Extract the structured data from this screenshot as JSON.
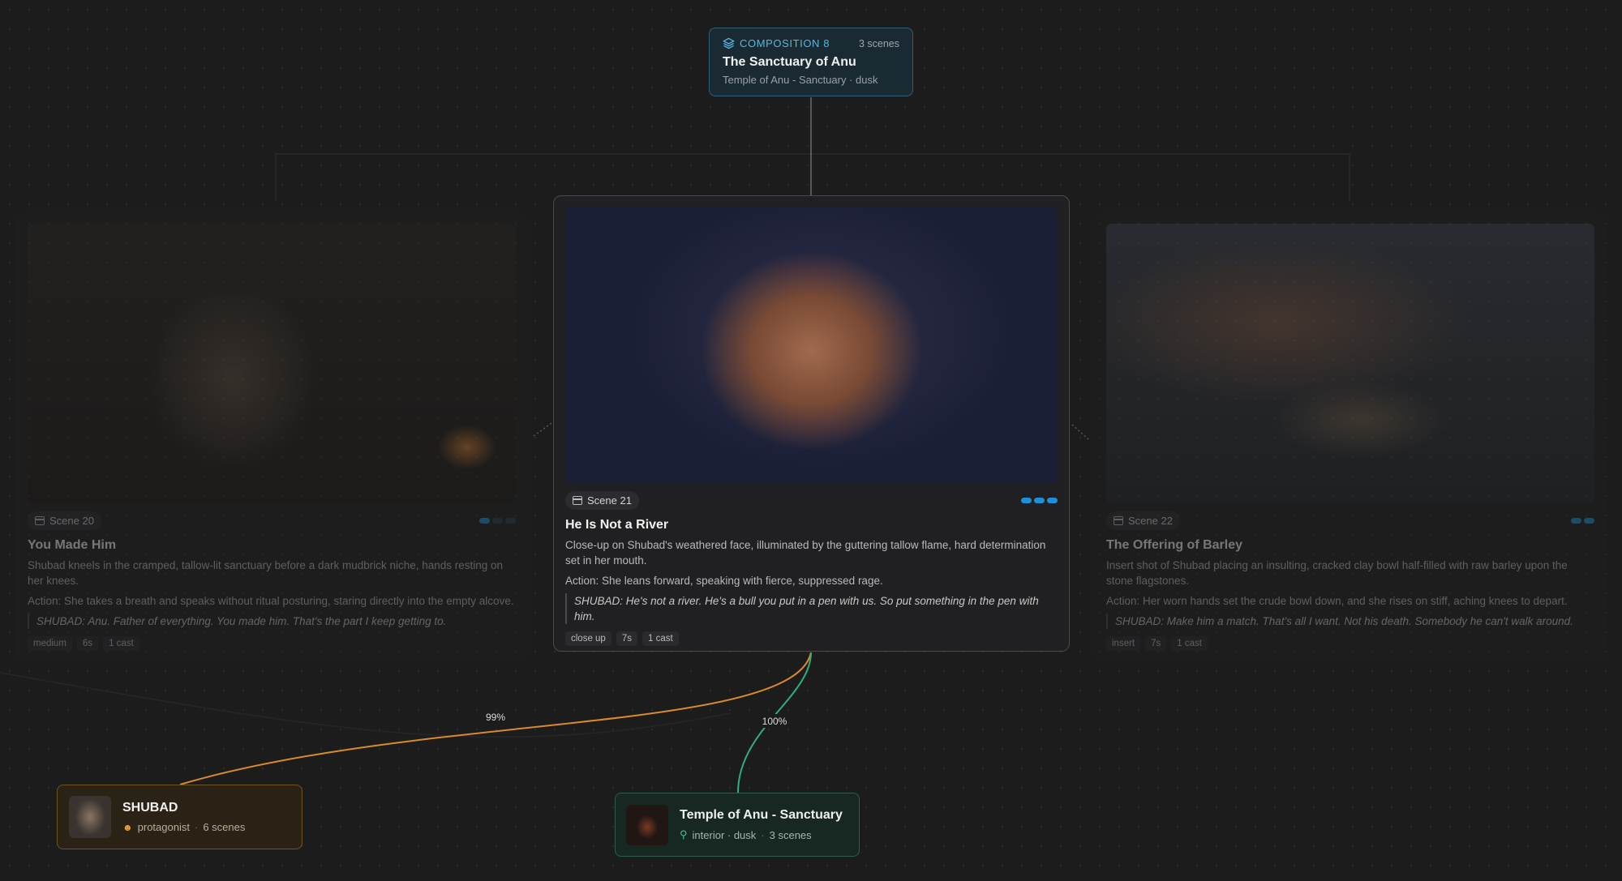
{
  "composition": {
    "tag": "COMPOSITION 8",
    "count": "3 scenes",
    "title": "The Sanctuary of Anu",
    "subtitle": "Temple of Anu - Sanctuary · dusk",
    "icon": "layers-icon"
  },
  "scenes": {
    "left": {
      "label": "Scene 20",
      "title": "You Made Him",
      "description": "Shubad kneels in the cramped, tallow-lit sanctuary before a dark mudbrick niche, hands resting on her knees.",
      "action": "Action: She takes a breath and speaks without ritual posturing, staring directly into the empty alcove.",
      "dialogue": "SHUBAD: Anu. Father of everything. You made him. That's the part I keep getting to.",
      "tags": [
        "medium",
        "6s",
        "1 cast"
      ]
    },
    "main": {
      "label": "Scene 21",
      "title": "He Is Not a River",
      "description": "Close-up on Shubad's weathered face, illuminated by the guttering tallow flame, hard determination set in her mouth.",
      "action": "Action: She leans forward, speaking with fierce, suppressed rage.",
      "dialogue": "SHUBAD: He's not a river. He's a bull you put in a pen with us. So put something in the pen with him.",
      "tags": [
        "close up",
        "7s",
        "1 cast"
      ]
    },
    "right": {
      "label": "Scene 22",
      "title": "The Offering of Barley",
      "description": "Insert shot of Shubad placing an insulting, cracked clay bowl half-filled with raw barley upon the stone flagstones.",
      "action": "Action: Her worn hands set the crude bowl down, and she rises on stiff, aching knees to depart.",
      "dialogue": "SHUBAD: Make him a match. That's all I want. Not his death. Somebody he can't walk around.",
      "tags": [
        "insert",
        "7s",
        "1 cast"
      ]
    }
  },
  "edges": {
    "character_pct": "99%",
    "location_pct": "100%"
  },
  "character": {
    "name": "SHUBAD",
    "role": "protagonist",
    "scenes": "6 scenes"
  },
  "location": {
    "name": "Temple of Anu - Sanctuary",
    "details": "interior · dusk",
    "scenes": "3 scenes"
  },
  "colors": {
    "accent_blue": "#1e8fd8",
    "character_edge": "#d98a2b",
    "location_edge": "#2fae7c"
  }
}
